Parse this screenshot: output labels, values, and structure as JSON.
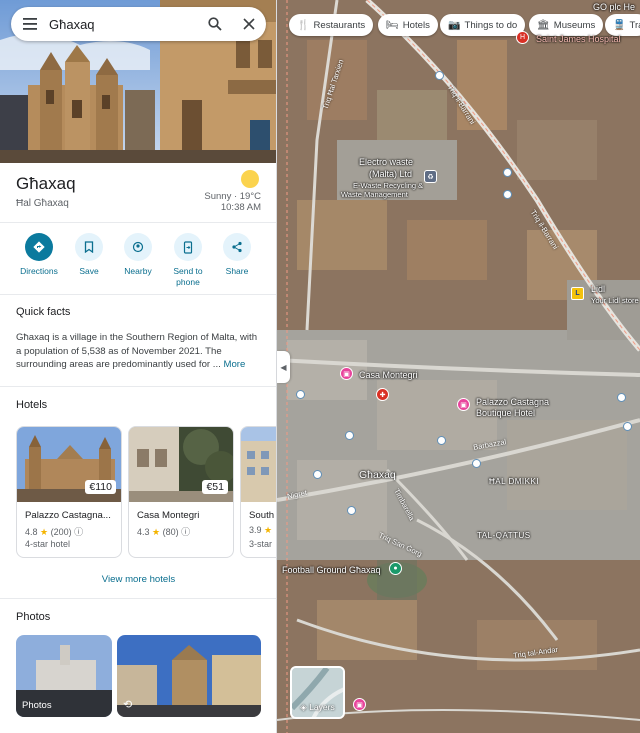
{
  "search": {
    "value": "Għaxaq",
    "placeholder": "Search Google Maps"
  },
  "place": {
    "title": "Għaxaq",
    "subtitle": "Ħal Għaxaq"
  },
  "weather": {
    "condition": "Sunny · 19°C",
    "time": "10:38 AM",
    "icon": "sun-icon"
  },
  "actions": [
    {
      "label": "Directions",
      "icon": "directions-icon"
    },
    {
      "label": "Save",
      "icon": "bookmark-icon"
    },
    {
      "label": "Nearby",
      "icon": "nearby-icon"
    },
    {
      "label": "Send to phone",
      "icon": "phone-icon"
    },
    {
      "label": "Share",
      "icon": "share-icon"
    }
  ],
  "quick_facts": {
    "title": "Quick facts",
    "text": "Għaxaq is a village in the Southern Region of Malta, with a population of 5,538 as of November 2021. The surrounding areas are predominantly used for ...",
    "more": "More"
  },
  "hotels": {
    "title": "Hotels",
    "items": [
      {
        "name": "Palazzo Castagna...",
        "price": "€110",
        "rating": "4.8",
        "reviews": "(200)",
        "class": "4-star hotel"
      },
      {
        "name": "Casa Montegri",
        "price": "€51",
        "rating": "4.3",
        "reviews": "(80)",
        "class": ""
      },
      {
        "name": "South",
        "price": "",
        "rating": "3.9",
        "reviews": "",
        "class": "3-star"
      }
    ],
    "view_more": "View more hotels"
  },
  "photos": {
    "title": "Photos",
    "items": [
      {
        "caption": "Photos"
      },
      {
        "caption": ""
      }
    ]
  },
  "map": {
    "chips": [
      {
        "label": "Restaurants",
        "icon": "fork-knife-icon"
      },
      {
        "label": "Hotels",
        "icon": "bed-icon"
      },
      {
        "label": "Things to do",
        "icon": "camera-icon"
      },
      {
        "label": "Museums",
        "icon": "museum-icon"
      },
      {
        "label": "Tra",
        "icon": "train-icon"
      }
    ],
    "labels": {
      "st_james": "Saint James Hospital",
      "gcplc": "GO plc He",
      "electro": "Electro waste",
      "electro2": "(Malta) Ltd",
      "ewaste": "E-Waste Recycling &",
      "ewaste2": "Waste Management",
      "lidl": "Lidl",
      "lidl_sub": "Your Lidl store",
      "casa": "Casa Montegri",
      "palazzo": "Palazzo Castagna",
      "palazzo2": "Boutique Hotel",
      "ghaxaq": "Għaxaq",
      "dmikki": "ĦAL DMIKKI",
      "qattus": "TAL-QATTUS",
      "football": "Football Ground Għaxaq",
      "layers": "Layers"
    },
    "roads": {
      "malta": "Triq Ħal Tarxien",
      "barrani": "Triq il-Barrani",
      "barrani2": "Triq il-Barrani",
      "barbazzal": "Barbazzal",
      "nigret": "Nigret",
      "timbarella": "Timbarella",
      "sangorg": "Triq San Ġorġ",
      "andar": "Triq tal-Andar"
    }
  }
}
